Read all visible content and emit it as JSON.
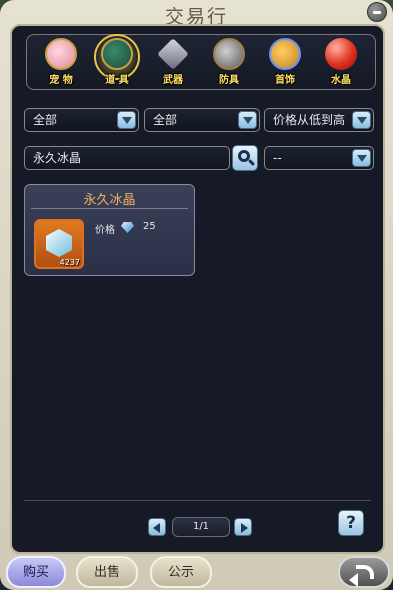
{
  "window": {
    "title": "交易行"
  },
  "categories": [
    {
      "label": "宠 物",
      "icon": "pet-icon",
      "active": false
    },
    {
      "label": "道 具",
      "icon": "item-icon",
      "active": true
    },
    {
      "label": "武器",
      "icon": "weapon-icon",
      "active": false
    },
    {
      "label": "防具",
      "icon": "armor-icon",
      "active": false
    },
    {
      "label": "首饰",
      "icon": "jewelry-icon",
      "active": false
    },
    {
      "label": "水晶",
      "icon": "crystal-icon",
      "active": false
    }
  ],
  "filters": {
    "filter1": "全部",
    "filter2": "全部",
    "sort": "价格从低到高",
    "search_value": "永久冰晶",
    "sub_filter": "--"
  },
  "listing": {
    "name": "永久冰晶",
    "count": "4237",
    "price_label": "价格",
    "price_currency_icon": "diamond-icon",
    "price_value": "25"
  },
  "pagination": {
    "page": "1/1"
  },
  "help": {
    "label": "?"
  },
  "bottom_tabs": {
    "buy": "购买",
    "sell": "出售",
    "notice": "公示"
  }
}
